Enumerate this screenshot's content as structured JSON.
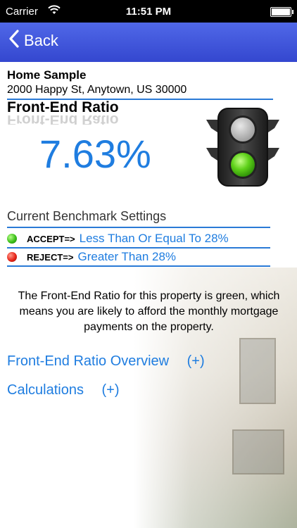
{
  "status_bar": {
    "carrier": "Carrier",
    "time": "11:51 PM"
  },
  "nav": {
    "back_label": "Back"
  },
  "property": {
    "name": "Home Sample",
    "address": "2000 Happy St, Anytown, US 30000"
  },
  "ratio": {
    "title": "Front-End Ratio",
    "value": "7.63%",
    "light_status": "green"
  },
  "benchmark": {
    "heading": "Current Benchmark Settings",
    "rows": [
      {
        "key": "ACCEPT=>",
        "value": "Less Than Or Equal To 28%",
        "color": "#3bbf19"
      },
      {
        "key": "REJECT=>",
        "value": "Greater Than 28%",
        "color": "#e8261a"
      }
    ]
  },
  "description": "The Front-End Ratio for this property is green, which means you are likely to afford the monthly mortgage payments on the property.",
  "sections": [
    {
      "label": "Front-End Ratio Overview",
      "toggle": "(+)"
    },
    {
      "label": "Calculations",
      "toggle": "(+)"
    }
  ],
  "colors": {
    "accent": "#1f7de0",
    "nav_bar": "#3f55dd",
    "rule": "#2a7ad6"
  }
}
